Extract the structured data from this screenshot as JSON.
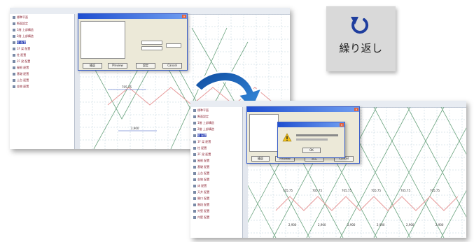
{
  "repeat_button": {
    "label": "繰り返し",
    "icon": "undo-arrow-icon",
    "accent": "#1f3e9e"
  },
  "flow_arrow": {
    "icon": "curved-arrow-icon",
    "color": "#1e60b8"
  },
  "screen_back": {
    "tree_items": [
      "標準平面",
      "断面設定",
      "1階 上部構造",
      "2階 上部構造",
      "壁 配置",
      "1F 梁 配置",
      "柱 配置",
      "2F 梁 配置",
      "屋根 配置",
      "基礎 配置",
      "土台 配置",
      "金物 配置"
    ],
    "selected_item": 4,
    "dialog_buttons": [
      "繰返",
      "Preview",
      "設定",
      "Cancel"
    ],
    "dim_label": "705.75",
    "base_label": "2,900"
  },
  "screen_front": {
    "tree_items": [
      "標準平面",
      "断面設定",
      "1階 上部構造",
      "2階 上部構造",
      "壁 配置",
      "1F 梁 配置",
      "柱 配置",
      "2F 梁 配置",
      "屋根 配置",
      "基礎 配置",
      "土台 配置",
      "金物 配置",
      "床 配置",
      "天井 配置",
      "開口 配置",
      "階段 配置",
      "外壁 配置",
      "内壁 配置"
    ],
    "selected_item": 4,
    "dialog_buttons": [
      "繰返",
      "Preview",
      "設定",
      "Cancel"
    ],
    "message_box": {
      "ok_label": "OK"
    },
    "dim_labels": [
      "705.75",
      "705.75",
      "705.75",
      "705.75",
      "705.75",
      "705.75"
    ],
    "base_labels": [
      "2,900",
      "2,900",
      "2,900",
      "2,900",
      "2,900",
      "2,900"
    ]
  }
}
